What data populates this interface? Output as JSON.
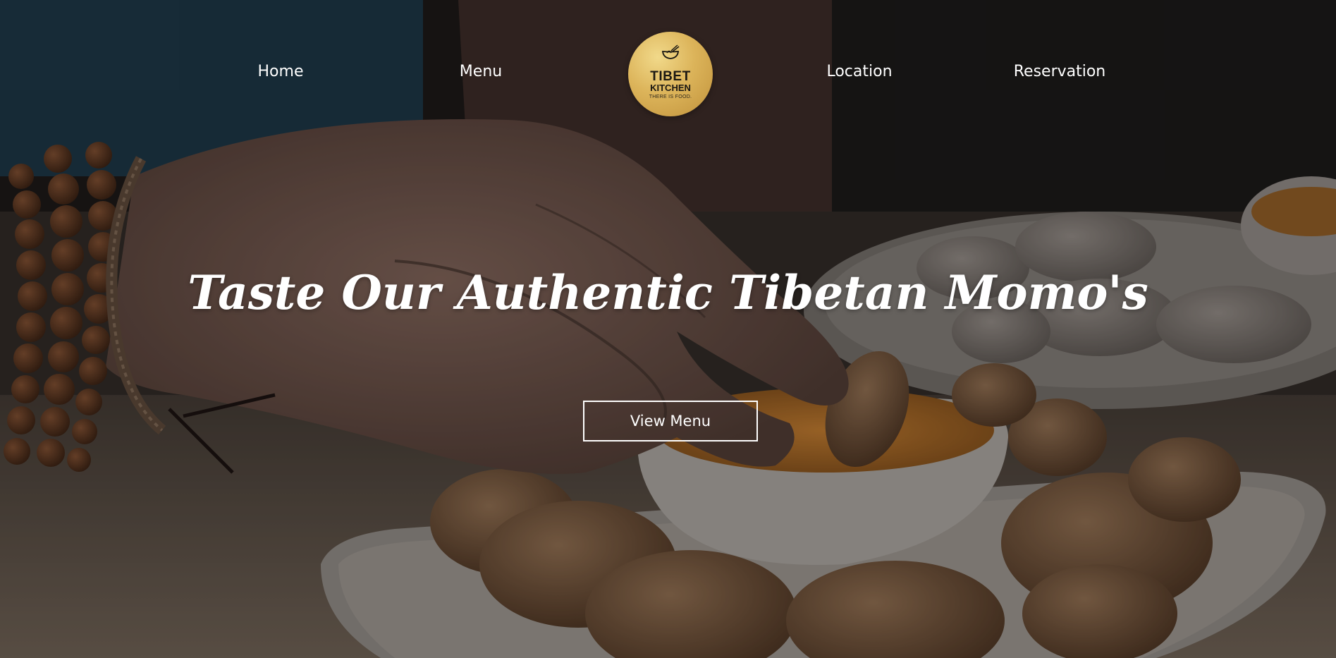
{
  "nav": {
    "items": [
      {
        "label": "Home"
      },
      {
        "label": "Menu"
      },
      {
        "label": "Location"
      },
      {
        "label": "Reservation"
      }
    ]
  },
  "logo": {
    "line1": "TIBET",
    "line2": "KITCHEN",
    "line3": "THERE IS FOOD.",
    "icon": "noodle-bowl-icon"
  },
  "hero": {
    "headline": "Taste Our Authentic Tibetan Momo's",
    "cta_label": "View Menu",
    "background": "photo of hand dipping momo dumpling into sauce, plate of momos"
  },
  "colors": {
    "logo_gold": "#dcb45a",
    "text": "#ffffff"
  }
}
